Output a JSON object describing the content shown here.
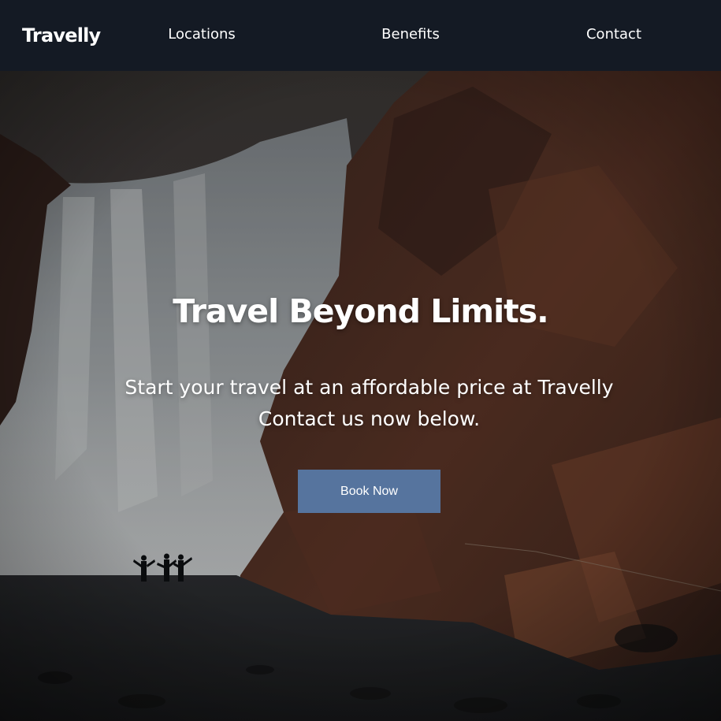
{
  "header": {
    "logo": "Travelly",
    "nav": [
      {
        "label": "Locations"
      },
      {
        "label": "Benefits"
      },
      {
        "label": "Contact"
      }
    ]
  },
  "hero": {
    "title": "Travel Beyond Limits.",
    "subtitle_line1": "Start your travel at an affordable price at Travelly",
    "subtitle_line2": "Contact us now below.",
    "cta_label": "Book Now",
    "background": "waterfall-with-rust-colored-cliffs-and-three-people-photo"
  },
  "colors": {
    "nav_bg": "#141a24",
    "button_bg": "#56749e",
    "text": "#ffffff"
  }
}
